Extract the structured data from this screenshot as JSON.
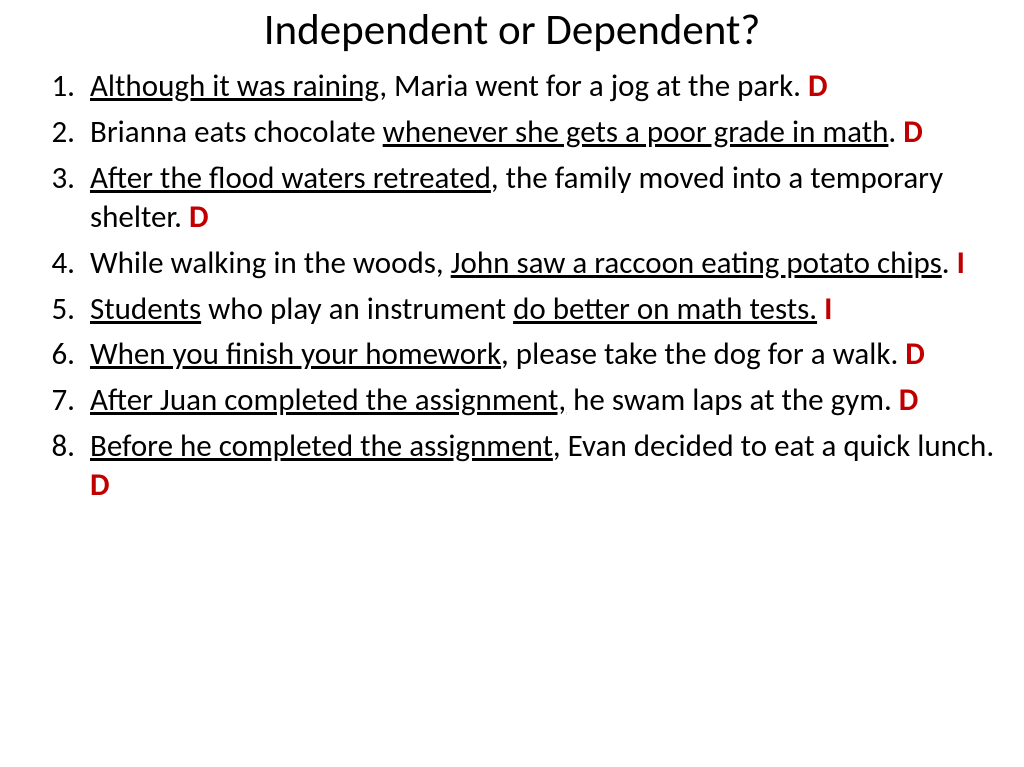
{
  "title": "Independent or Dependent?",
  "items": [
    {
      "ul_before": "Although it was raining",
      "plain_mid": ", Maria went for a jog at the park. ",
      "answer": "D"
    },
    {
      "plain_before": "Brianna eats chocolate ",
      "ul_mid": "whenever she gets a poor grade in math",
      "plain_after": ".   ",
      "answer": "D"
    },
    {
      "ul_before": "After the flood waters retreated",
      "plain_mid": ", the family moved into a temporary shelter.   ",
      "answer": "D"
    },
    {
      "plain_before": "While walking in the woods, ",
      "ul_mid": "John saw a raccoon eating potato chips",
      "plain_after": ".    ",
      "answer": "I"
    },
    {
      "ul_before": "Students",
      "plain_mid": " who play an instrument  ",
      "ul_after": "do better on math tests.",
      "plain_tail": "   ",
      "answer": "I"
    },
    {
      "ul_before": "When you finish your homework",
      "plain_mid": ", please take the dog for a walk. ",
      "answer": "D"
    },
    {
      "ul_before": "After Juan completed the assignment,",
      "plain_mid": " he swam laps at the gym.   ",
      "answer": "D"
    },
    {
      "ul_before": "Before he completed the assignment",
      "plain_mid": ", Evan decided to eat a quick lunch.   ",
      "answer": "D"
    }
  ]
}
